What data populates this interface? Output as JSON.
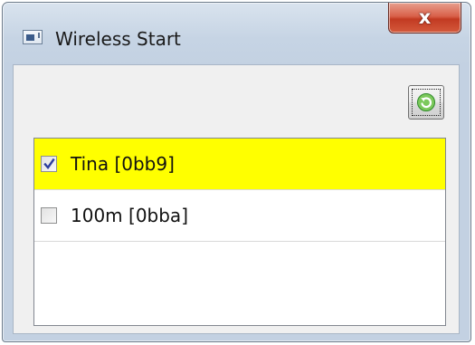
{
  "window": {
    "title": "Wireless Start",
    "close_label": "x"
  },
  "icons": {
    "app": "window-app-icon",
    "refresh": "refresh-icon",
    "close": "close-icon"
  },
  "devices": [
    {
      "label": "Tina [0bb9]",
      "checked": true,
      "selected": true
    },
    {
      "label": "100m [0bba]",
      "checked": false,
      "selected": false
    }
  ],
  "colors": {
    "selected_row": "#ffff00",
    "close_button": "#c8432b",
    "refresh_arrow": "#3aa62f"
  }
}
